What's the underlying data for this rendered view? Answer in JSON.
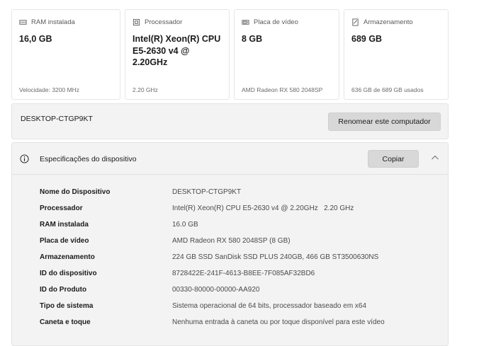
{
  "cards": [
    {
      "icon": "ram-icon",
      "label": "RAM instalada",
      "value": "16,0 GB",
      "sub": "Velocidade: 3200 MHz"
    },
    {
      "icon": "processor-icon",
      "label": "Processador",
      "value": "Intel(R) Xeon(R) CPU E5-2630 v4 @ 2.20GHz",
      "sub": "2.20 GHz"
    },
    {
      "icon": "gpu-icon",
      "label": "Placa de vídeo",
      "value": "8 GB",
      "sub": "AMD Radeon RX 580 2048SP"
    },
    {
      "icon": "storage-icon",
      "label": "Armazenamento",
      "value": "689 GB",
      "sub": "636 GB de 689 GB usados"
    }
  ],
  "rename": {
    "computer_name": "DESKTOP-CTGP9KT",
    "button_label": "Renomear este computador"
  },
  "specs": {
    "title": "Especificações do dispositivo",
    "copy_label": "Copiar",
    "rows": [
      {
        "key": "Nome do Dispositivo",
        "value": "DESKTOP-CTGP9KT"
      },
      {
        "key": "Processador",
        "value": "Intel(R) Xeon(R) CPU E5-2630 v4 @ 2.20GHz   2.20 GHz"
      },
      {
        "key": "RAM instalada",
        "value": "16.0 GB"
      },
      {
        "key": "Placa de vídeo",
        "value": "AMD Radeon RX 580 2048SP (8 GB)"
      },
      {
        "key": "Armazenamento",
        "value": "224 GB SSD SanDisk SSD PLUS 240GB, 466 GB ST3500630NS"
      },
      {
        "key": "ID do dispositivo",
        "value": "8728422E-241F-4613-B8EE-7F085AF32BD6"
      },
      {
        "key": "ID do Produto",
        "value": "00330-80000-00000-AA920"
      },
      {
        "key": "Tipo de sistema",
        "value": "Sistema operacional de 64 bits, processador baseado em x64"
      },
      {
        "key": "Caneta e toque",
        "value": "Nenhuma entrada à caneta ou por toque disponível para este vídeo"
      }
    ]
  }
}
